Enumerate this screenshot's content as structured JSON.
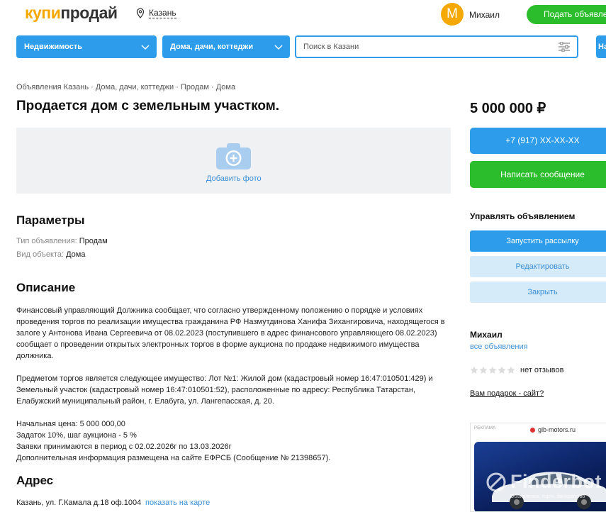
{
  "header": {
    "logo_part1": "купи",
    "logo_part2": "продай",
    "city": "Казань",
    "avatar_letter": "М",
    "username": "Михаил",
    "post_button": "Подать объявление"
  },
  "searchbar": {
    "category": "Недвижимость",
    "subcategory": "Дома, дачи, коттеджи",
    "search_placeholder": "Поиск в Казани",
    "find_button": "Найти"
  },
  "listing": {
    "breadcrumbs": "Объявления Казань · Дома, дачи, коттеджи · Продам · Дома",
    "title": "Продается дом с земельным участком.",
    "add_photo": "Добавить фото",
    "params_heading": "Параметры",
    "params": [
      {
        "key": "Тип объявления:",
        "value": "Продам"
      },
      {
        "key": "Вид объекта:",
        "value": "Дома"
      }
    ],
    "description_heading": "Описание",
    "description": [
      "Финансовый управляющий Должника сообщает, что согласно утвержденному положению о порядке и условиях проведения торгов по реализации имущества гражданина РФ Назмутдинова Ханифа Зихангировича, находящегося в залоге у Антонова Ивана Сергеевича от 08.02.2023 (поступившего в адрес финансового управляющего 08.02.2023) сообщает о проведении открытых электронных торгов в форме аукциона по продаже недвижимого имущества должника.",
      "Предметом торгов является следующее имущество: Лот №1: Жилой дом (кадастровый номер 16:47:010501:429) и Земельный участок (кадастровый номер 16:47:010501:52), расположенные по адресу: Республика Татарстан, Елабужский муниципальный район, г. Елабуга, ул. Лангепасская, д. 20.",
      "Начальная цена: 5 000 000,00\nЗадаток 10%, шаг аукциона - 5 %\nЗаявки принимаются в период с 02.02.2026г по 13.03.2026г\nДополнительная информация размещена на сайте ЕФРСБ (Сообщение № 21398657)."
    ],
    "address_heading": "Адрес",
    "address": "Казань, ул. Г.Камала д.18 оф.1004",
    "map_link": "показать на карте"
  },
  "sidebar": {
    "price": "5 000 000 ₽",
    "phone_button": "+7 (917) XX-XX-XX",
    "message_button": "Написать сообщение",
    "manage_heading": "Управлять объявлением",
    "manage_buttons": [
      "Запустить рассылку",
      "Редактировать",
      "Закрыть"
    ],
    "seller_name": "Михаил",
    "all_ads_link": "все объявления",
    "rating_stars": 0,
    "reviews": "нет отзывов",
    "gift_link": "Вам подарок - сайт?",
    "ad_label": "РЕКЛАМА",
    "ad_domain": "glb-motors.ru"
  },
  "watermark": {
    "name": "Finderbot",
    "tagline": "Объявления, торги, банкротство"
  },
  "colors": {
    "brand_orange": "#f5a800",
    "primary_blue": "#2d9cea",
    "green": "#2bbd2b",
    "link_blue": "#3b8fd6"
  },
  "icons": [
    "location-pin-icon",
    "chevron-down-icon",
    "filter-icon",
    "camera-plus-icon",
    "star-icon",
    "finderbot-logo-icon"
  ]
}
